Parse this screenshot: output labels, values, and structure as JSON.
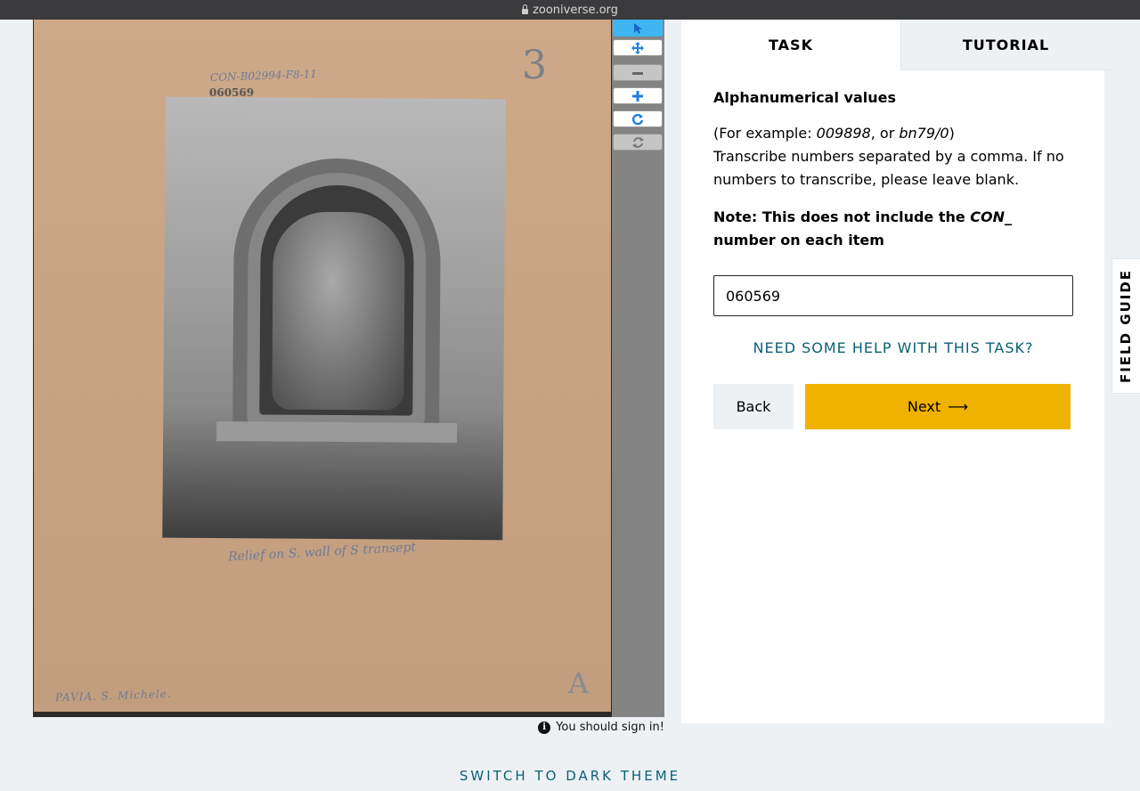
{
  "browser": {
    "url": "zooniverse.org"
  },
  "subject": {
    "handwriting": {
      "code": "CON-B02994-F8-11",
      "number": "060569",
      "corner_number": "3",
      "caption": "Relief on S. wall of S transept",
      "location": "PAVIA. S. Michele.",
      "corner_letter": "A"
    }
  },
  "toolbar": {
    "tools": [
      {
        "name": "annotate",
        "icon": "pointer-icon"
      },
      {
        "name": "move",
        "icon": "move-icon"
      },
      {
        "name": "zoom-out",
        "icon": "minus-icon"
      },
      {
        "name": "zoom-in",
        "icon": "plus-icon"
      },
      {
        "name": "rotate",
        "icon": "rotate-icon"
      },
      {
        "name": "reset",
        "icon": "reset-icon"
      }
    ]
  },
  "signin_notice": "You should sign in!",
  "tabs": {
    "task": "TASK",
    "tutorial": "TUTORIAL"
  },
  "task": {
    "title": "Alphanumerical values",
    "example_prefix": "(For example: ",
    "example_1": "009898",
    "example_sep": ", or ",
    "example_2": "bn79/0",
    "example_suffix": ")",
    "instruction": "Transcribe numbers separated by a comma. If no numbers to transcribe, please leave blank.",
    "note_prefix": "Note: This does not include the ",
    "note_em": "CON_",
    "note_suffix": " number on each item",
    "answer_value": "060569",
    "help_link": "NEED SOME HELP WITH THIS TASK?",
    "back_label": "Back",
    "next_label": "Next",
    "next_arrow": "⟶"
  },
  "field_guide_label": "FIELD GUIDE",
  "theme_toggle_label": "SWITCH TO DARK THEME"
}
